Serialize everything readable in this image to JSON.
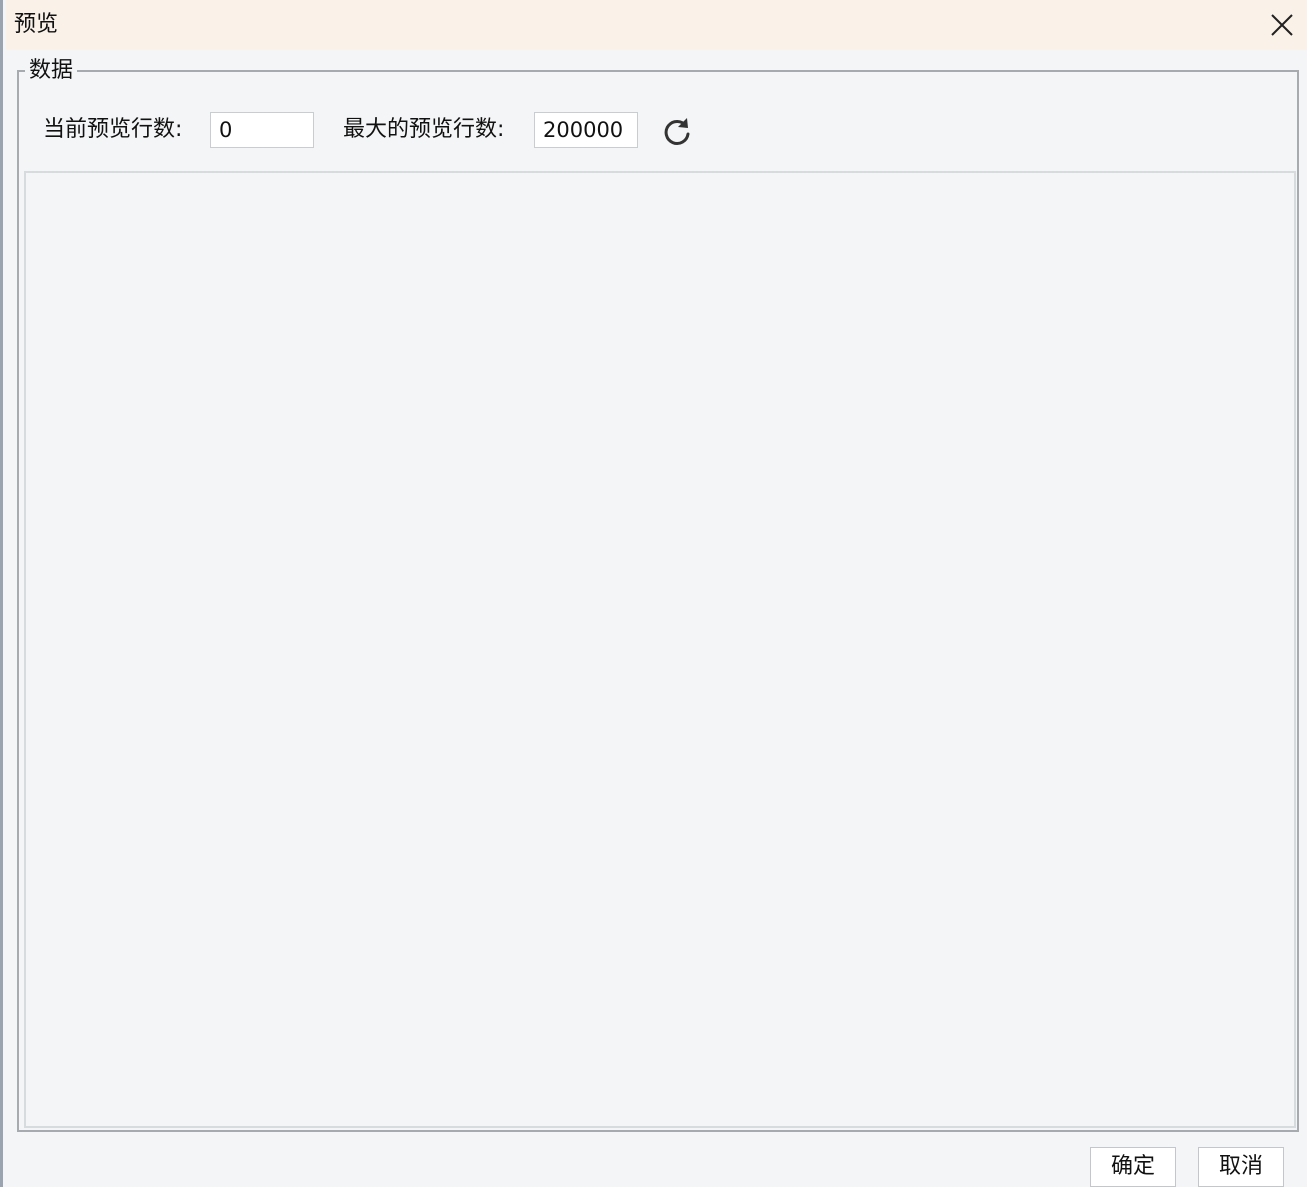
{
  "window": {
    "title": "预览",
    "close_icon": "close-icon"
  },
  "data_group": {
    "legend": "数据",
    "current_rows_label": "当前预览行数:",
    "current_rows_value": "0",
    "max_rows_label": "最大的预览行数:",
    "max_rows_value": "200000",
    "refresh_icon": "refresh-icon"
  },
  "footer": {
    "ok_label": "确定",
    "cancel_label": "取消"
  },
  "colors": {
    "titlebar_bg": "#faf1e9",
    "panel_bg": "#f4f5f7",
    "border": "#a7abb0"
  }
}
